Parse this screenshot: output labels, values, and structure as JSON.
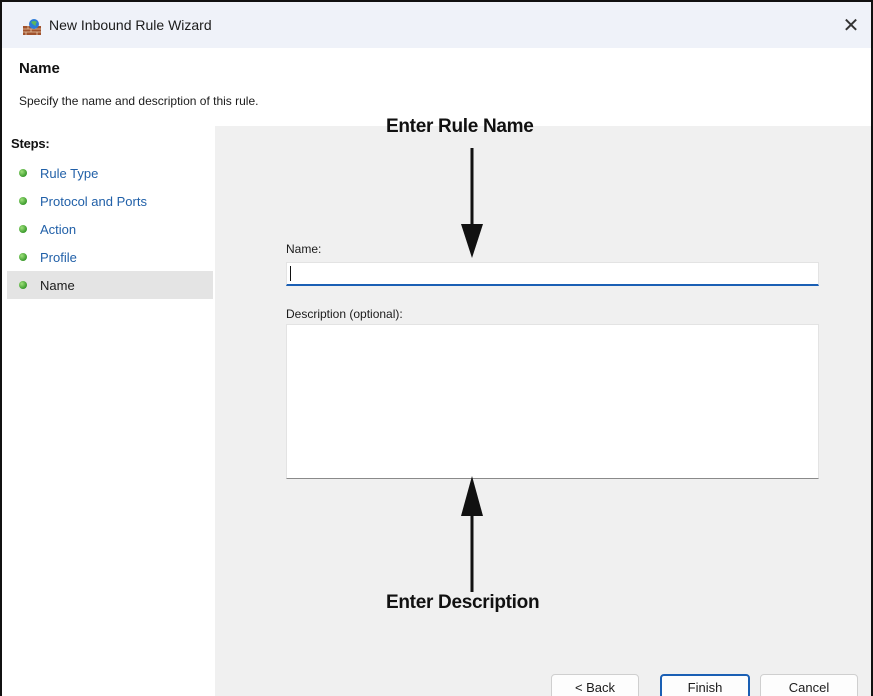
{
  "window": {
    "title": "New Inbound Rule Wizard",
    "close_glyph": "✕"
  },
  "header": {
    "title": "Name",
    "subtitle": "Specify the name and description of this rule."
  },
  "steps": {
    "heading": "Steps:",
    "items": [
      {
        "label": "Rule Type"
      },
      {
        "label": "Protocol and Ports"
      },
      {
        "label": "Action"
      },
      {
        "label": "Profile"
      },
      {
        "label": "Name"
      }
    ],
    "active_index": 4
  },
  "form": {
    "name_label": "Name:",
    "name_value": "",
    "description_label": "Description (optional):",
    "description_value": ""
  },
  "annotations": {
    "name_callout": "Enter Rule Name",
    "description_callout": "Enter Description"
  },
  "buttons": {
    "back": "< Back",
    "finish": "Finish",
    "cancel": "Cancel"
  },
  "colors": {
    "accent": "#1a5fb4",
    "step_link": "#2160a8",
    "titlebar": "#eff2f9",
    "panel_bg": "#f0f0f0"
  },
  "icons": {
    "app": "firewall-wizard-icon",
    "step_bullet": "green-dot-icon",
    "close": "close-icon"
  }
}
